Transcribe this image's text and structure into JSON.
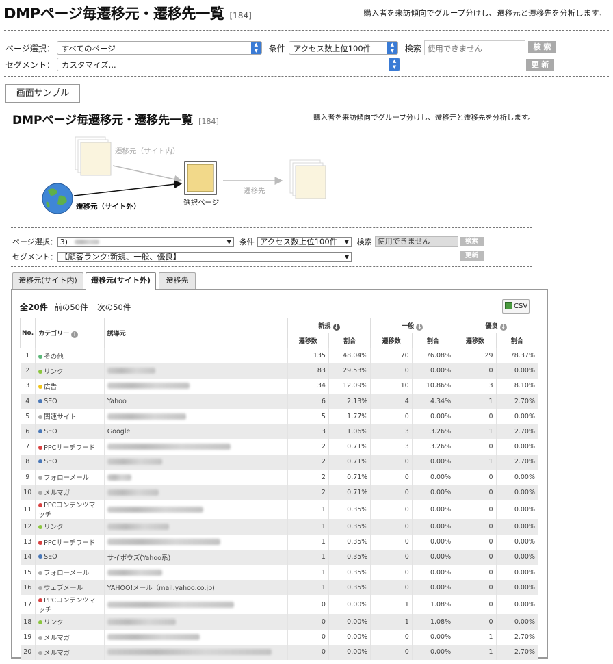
{
  "header": {
    "title": "DMPページ毎遷移元・遷移先一覧",
    "count": "[184]",
    "description": "購入者を来訪傾向でグループ分けし、遷移元と遷移先を分析します。"
  },
  "filters": {
    "page_label": "ページ選択：",
    "page_value": "すべてのページ",
    "condition_label": "条件",
    "condition_value": "アクセス数上位100件",
    "search_label": "検索",
    "search_placeholder": "使用できません",
    "search_button": "検 索",
    "segment_label": "セグメント：",
    "segment_value": "カスタマイズ...",
    "update_button": "更 新"
  },
  "sample_button": "画面サンプル",
  "sample": {
    "title": "DMPページ毎遷移元・遷移先一覧",
    "count": "[184]",
    "description": "購入者を来訪傾向でグループ分けし、遷移元と遷移先を分析します。",
    "diagram": {
      "source_internal": "遷移元（サイト内）",
      "source_external": "遷移元（サイト外）",
      "selected_page": "選択ページ",
      "destination": "遷移先"
    },
    "filters": {
      "page_label": "ページ選択：",
      "page_value": "3)",
      "condition_label": "条件",
      "condition_value": "アクセス数上位100件",
      "search_label": "検索",
      "search_value": "使用できません",
      "search_button": "検索",
      "segment_label": "セグメント：",
      "segment_value": "【顧客ランク:新規、一般、優良】",
      "update_button": "更新"
    },
    "tabs": [
      "遷移元(サイト内)",
      "遷移元(サイト外)",
      "遷移先"
    ],
    "active_tab": 1,
    "pagination": {
      "total": "全20件",
      "prev": "前の50件",
      "next": "次の50件"
    },
    "csv_label": "CSV",
    "table": {
      "headers": {
        "no": "No.",
        "category": "カテゴリー",
        "referrer": "誘導元",
        "new": "新規",
        "general": "一般",
        "premium": "優良",
        "visits": "遷移数",
        "ratio": "割合"
      },
      "rows": [
        {
          "no": "1",
          "category": "その他",
          "color": "#5db87a",
          "referrer": "",
          "blur": 0,
          "n_v": "135",
          "n_r": "48.04%",
          "g_v": "70",
          "g_r": "76.08%",
          "p_v": "29",
          "p_r": "78.37%"
        },
        {
          "no": "2",
          "category": "リンク",
          "color": "#8cc63f",
          "referrer": "",
          "blur": 70,
          "n_v": "83",
          "n_r": "29.53%",
          "g_v": "0",
          "g_r": "0.00%",
          "p_v": "0",
          "p_r": "0.00%"
        },
        {
          "no": "3",
          "category": "広告",
          "color": "#f0c419",
          "referrer": "",
          "blur": 120,
          "n_v": "34",
          "n_r": "12.09%",
          "g_v": "10",
          "g_r": "10.86%",
          "p_v": "3",
          "p_r": "8.10%"
        },
        {
          "no": "4",
          "category": "SEO",
          "color": "#4a78b8",
          "referrer": "Yahoo",
          "blur": 0,
          "n_v": "6",
          "n_r": "2.13%",
          "g_v": "4",
          "g_r": "4.34%",
          "p_v": "1",
          "p_r": "2.70%"
        },
        {
          "no": "5",
          "category": "関連サイト",
          "color": "#aaaaaa",
          "referrer": "",
          "blur": 115,
          "n_v": "5",
          "n_r": "1.77%",
          "g_v": "0",
          "g_r": "0.00%",
          "p_v": "0",
          "p_r": "0.00%"
        },
        {
          "no": "6",
          "category": "SEO",
          "color": "#4a78b8",
          "referrer": "Google",
          "blur": 0,
          "n_v": "3",
          "n_r": "1.06%",
          "g_v": "3",
          "g_r": "3.26%",
          "p_v": "1",
          "p_r": "2.70%"
        },
        {
          "no": "7",
          "category": "PPCサーチワード",
          "color": "#d94141",
          "referrer": "",
          "blur": 180,
          "n_v": "2",
          "n_r": "0.71%",
          "g_v": "3",
          "g_r": "3.26%",
          "p_v": "0",
          "p_r": "0.00%"
        },
        {
          "no": "8",
          "category": "SEO",
          "color": "#4a78b8",
          "referrer": "",
          "blur": 80,
          "n_v": "2",
          "n_r": "0.71%",
          "g_v": "0",
          "g_r": "0.00%",
          "p_v": "1",
          "p_r": "2.70%"
        },
        {
          "no": "9",
          "category": "フォローメール",
          "color": "#aaaaaa",
          "referrer": "",
          "blur": 35,
          "n_v": "2",
          "n_r": "0.71%",
          "g_v": "0",
          "g_r": "0.00%",
          "p_v": "0",
          "p_r": "0.00%"
        },
        {
          "no": "10",
          "category": "メルマガ",
          "color": "#aaaaaa",
          "referrer": "",
          "blur": 75,
          "n_v": "2",
          "n_r": "0.71%",
          "g_v": "0",
          "g_r": "0.00%",
          "p_v": "0",
          "p_r": "0.00%"
        },
        {
          "no": "11",
          "category": "PPCコンテンツマッチ",
          "color": "#d94141",
          "referrer": "",
          "blur": 140,
          "n_v": "1",
          "n_r": "0.35%",
          "g_v": "0",
          "g_r": "0.00%",
          "p_v": "0",
          "p_r": "0.00%"
        },
        {
          "no": "12",
          "category": "リンク",
          "color": "#8cc63f",
          "referrer": "",
          "blur": 90,
          "n_v": "1",
          "n_r": "0.35%",
          "g_v": "0",
          "g_r": "0.00%",
          "p_v": "0",
          "p_r": "0.00%"
        },
        {
          "no": "13",
          "category": "PPCサーチワード",
          "color": "#d94141",
          "referrer": "",
          "blur": 165,
          "n_v": "1",
          "n_r": "0.35%",
          "g_v": "0",
          "g_r": "0.00%",
          "p_v": "0",
          "p_r": "0.00%"
        },
        {
          "no": "14",
          "category": "SEO",
          "color": "#4a78b8",
          "referrer": "サイボウズ(Yahoo系)",
          "blur": 0,
          "n_v": "1",
          "n_r": "0.35%",
          "g_v": "0",
          "g_r": "0.00%",
          "p_v": "0",
          "p_r": "0.00%"
        },
        {
          "no": "15",
          "category": "フォローメール",
          "color": "#aaaaaa",
          "referrer": "",
          "blur": 80,
          "n_v": "1",
          "n_r": "0.35%",
          "g_v": "0",
          "g_r": "0.00%",
          "p_v": "0",
          "p_r": "0.00%"
        },
        {
          "no": "16",
          "category": "ウェブメール",
          "color": "#aaaaaa",
          "referrer": "YAHOO!メール（mail.yahoo.co.jp)",
          "blur": 0,
          "n_v": "1",
          "n_r": "0.35%",
          "g_v": "0",
          "g_r": "0.00%",
          "p_v": "0",
          "p_r": "0.00%"
        },
        {
          "no": "17",
          "category": "PPCコンテンツマッチ",
          "color": "#d94141",
          "referrer": "",
          "blur": 185,
          "n_v": "0",
          "n_r": "0.00%",
          "g_v": "1",
          "g_r": "1.08%",
          "p_v": "0",
          "p_r": "0.00%"
        },
        {
          "no": "18",
          "category": "リンク",
          "color": "#8cc63f",
          "referrer": "",
          "blur": 100,
          "n_v": "0",
          "n_r": "0.00%",
          "g_v": "1",
          "g_r": "1.08%",
          "p_v": "0",
          "p_r": "0.00%"
        },
        {
          "no": "19",
          "category": "メルマガ",
          "color": "#aaaaaa",
          "referrer": "",
          "blur": 135,
          "n_v": "0",
          "n_r": "0.00%",
          "g_v": "0",
          "g_r": "0.00%",
          "p_v": "1",
          "p_r": "2.70%"
        },
        {
          "no": "20",
          "category": "メルマガ",
          "color": "#aaaaaa",
          "referrer": "",
          "blur": 240,
          "n_v": "0",
          "n_r": "0.00%",
          "g_v": "0",
          "g_r": "0.00%",
          "p_v": "1",
          "p_r": "2.70%"
        }
      ]
    }
  }
}
